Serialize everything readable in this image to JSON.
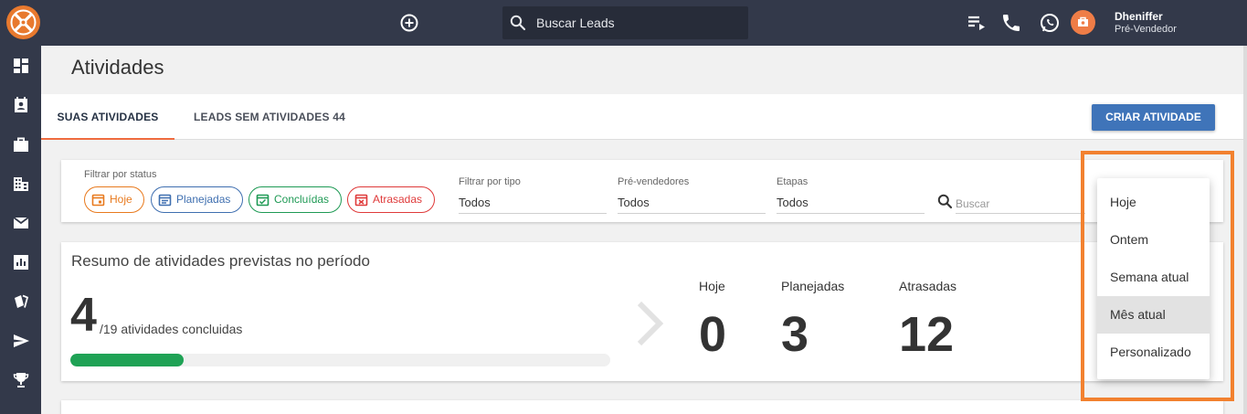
{
  "header": {
    "search_placeholder": "Buscar Leads",
    "user_name": "Dheniffer",
    "user_role": "Pré-Vendedor"
  },
  "sidebar": {
    "items": [
      "dashboard-icon",
      "contacts-icon",
      "briefcase-icon",
      "building-icon",
      "mail-icon",
      "chart-icon",
      "cards-icon",
      "send-icon",
      "trophy-icon"
    ]
  },
  "page": {
    "title": "Atividades",
    "tabs": [
      {
        "label": "SUAS ATIVIDADES",
        "active": true
      },
      {
        "label": "LEADS SEM ATIVIDADES 44",
        "active": false
      }
    ],
    "create_button": "CRIAR ATIVIDADE"
  },
  "filters": {
    "status_label": "Filtrar por status",
    "chips": [
      {
        "label": "Hoje",
        "color": "#e87a1e"
      },
      {
        "label": "Planejadas",
        "color": "#3f6fb0"
      },
      {
        "label": "Concluídas",
        "color": "#1f9a55"
      },
      {
        "label": "Atrasadas",
        "color": "#df3a3a"
      }
    ],
    "type_label": "Filtrar por tipo",
    "type_value": "Todos",
    "presales_label": "Pré-vendedores",
    "presales_value": "Todos",
    "stages_label": "Etapas",
    "stages_value": "Todos",
    "search_placeholder": "Buscar"
  },
  "summary": {
    "title": "Resumo de atividades previstas no período",
    "done": "4",
    "done_suffix": "/19 atividades concluidas",
    "progress_fraction": 0.21,
    "stats": [
      {
        "label": "Hoje",
        "value": "0"
      },
      {
        "label": "Planejadas",
        "value": "3"
      },
      {
        "label": "Atrasadas",
        "value": "12"
      }
    ]
  },
  "period_menu": {
    "options": [
      "Hoje",
      "Ontem",
      "Semana atual",
      "Mês atual",
      "Personalizado"
    ],
    "selected": "Mês atual"
  },
  "colors": {
    "topbar": "#33394a",
    "accent_orange": "#ef6b3f",
    "primary_blue": "#3f74b9",
    "progress_green": "#1fa255",
    "highlight_orange": "#f2812f"
  }
}
